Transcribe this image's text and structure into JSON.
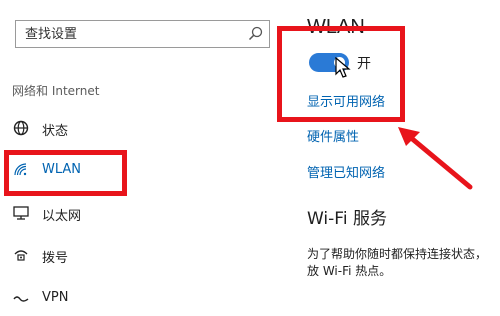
{
  "search": {
    "placeholder": "查找设置",
    "value": ""
  },
  "sidebar": {
    "section_title": "网络和 Internet",
    "items": [
      {
        "label": "状态",
        "icon": "globe-icon"
      },
      {
        "label": "WLAN",
        "icon": "wifi-icon",
        "active": true
      },
      {
        "label": "以太网",
        "icon": "ethernet-icon"
      },
      {
        "label": "拨号",
        "icon": "dialup-icon"
      },
      {
        "label": "VPN",
        "icon": "vpn-icon"
      }
    ]
  },
  "main": {
    "title": "WLAN",
    "toggle": {
      "state_label": "开",
      "on": true
    },
    "links": {
      "show_networks": "显示可用网络",
      "hardware_props": "硬件属性",
      "manage_known": "管理已知网络"
    },
    "wifi_services_title": "Wi-Fi 服务",
    "wifi_services_desc_line1": "为了帮助你随时都保持连接状态，",
    "wifi_services_desc_line2": "放 Wi-Fi 热点。"
  },
  "colors": {
    "accent": "#0063b1",
    "highlight_red": "#e8141b",
    "toggle_on": "#2a7ad6"
  }
}
